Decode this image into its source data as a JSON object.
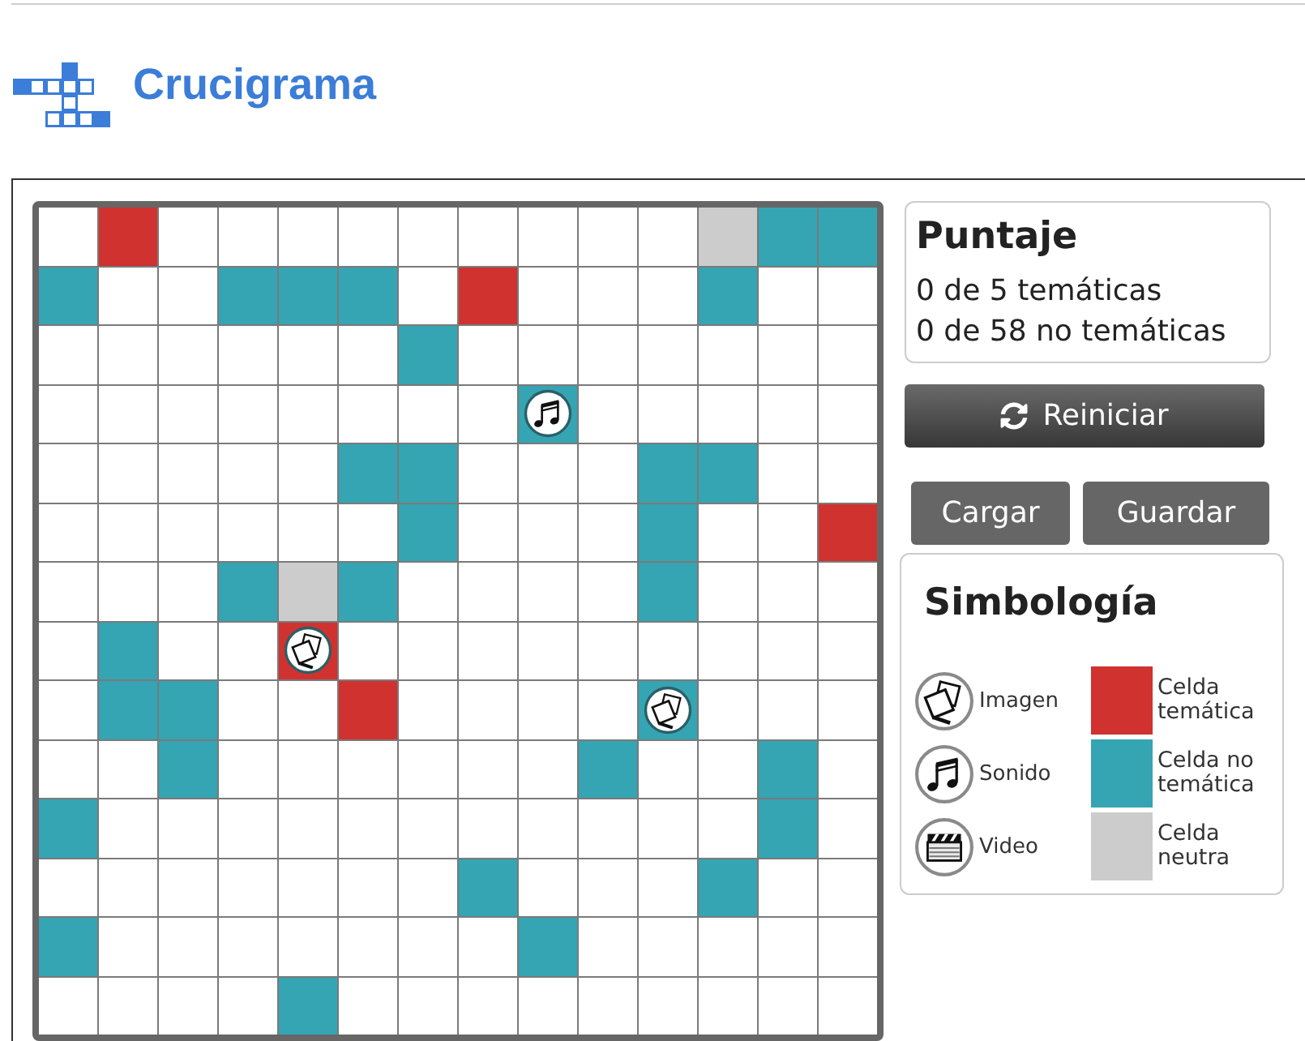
{
  "header": {
    "title": "Crucigrama"
  },
  "grid": {
    "rows": [
      [
        {
          "kind": "blank"
        },
        {
          "kind": "thematic"
        },
        {
          "kind": "blank"
        },
        {
          "kind": "blank"
        },
        {
          "kind": "blank"
        },
        {
          "kind": "blank"
        },
        {
          "kind": "blank"
        },
        {
          "kind": "blank"
        },
        {
          "kind": "blank"
        },
        {
          "kind": "blank"
        },
        {
          "kind": "blank"
        },
        {
          "kind": "neutral"
        },
        {
          "kind": "non_thematic"
        },
        {
          "kind": "non_thematic"
        }
      ],
      [
        {
          "kind": "non_thematic"
        },
        {
          "kind": "blank"
        },
        {
          "kind": "blank"
        },
        {
          "kind": "non_thematic"
        },
        {
          "kind": "non_thematic"
        },
        {
          "kind": "non_thematic"
        },
        {
          "kind": "blank"
        },
        {
          "kind": "thematic"
        },
        {
          "kind": "blank"
        },
        {
          "kind": "blank"
        },
        {
          "kind": "blank"
        },
        {
          "kind": "non_thematic"
        },
        {
          "kind": "blank"
        },
        {
          "kind": "blank"
        }
      ],
      [
        {
          "kind": "blank"
        },
        {
          "kind": "blank"
        },
        {
          "kind": "blank"
        },
        {
          "kind": "blank"
        },
        {
          "kind": "blank"
        },
        {
          "kind": "blank"
        },
        {
          "kind": "non_thematic"
        },
        {
          "kind": "blank"
        },
        {
          "kind": "blank"
        },
        {
          "kind": "blank"
        },
        {
          "kind": "blank"
        },
        {
          "kind": "blank"
        },
        {
          "kind": "blank"
        },
        {
          "kind": "blank"
        }
      ],
      [
        {
          "kind": "blank"
        },
        {
          "kind": "blank"
        },
        {
          "kind": "blank"
        },
        {
          "kind": "blank"
        },
        {
          "kind": "blank"
        },
        {
          "kind": "blank"
        },
        {
          "kind": "blank"
        },
        {
          "kind": "blank"
        },
        {
          "kind": "non_thematic",
          "media": {
            "kind": "sound"
          }
        },
        {
          "kind": "blank"
        },
        {
          "kind": "blank"
        },
        {
          "kind": "blank"
        },
        {
          "kind": "blank"
        },
        {
          "kind": "blank"
        }
      ],
      [
        {
          "kind": "blank"
        },
        {
          "kind": "blank"
        },
        {
          "kind": "blank"
        },
        {
          "kind": "blank"
        },
        {
          "kind": "blank"
        },
        {
          "kind": "non_thematic"
        },
        {
          "kind": "non_thematic"
        },
        {
          "kind": "blank"
        },
        {
          "kind": "blank"
        },
        {
          "kind": "blank"
        },
        {
          "kind": "non_thematic"
        },
        {
          "kind": "non_thematic"
        },
        {
          "kind": "blank"
        },
        {
          "kind": "blank"
        }
      ],
      [
        {
          "kind": "blank"
        },
        {
          "kind": "blank"
        },
        {
          "kind": "blank"
        },
        {
          "kind": "blank"
        },
        {
          "kind": "blank"
        },
        {
          "kind": "blank"
        },
        {
          "kind": "non_thematic"
        },
        {
          "kind": "blank"
        },
        {
          "kind": "blank"
        },
        {
          "kind": "blank"
        },
        {
          "kind": "non_thematic"
        },
        {
          "kind": "blank"
        },
        {
          "kind": "blank"
        },
        {
          "kind": "thematic"
        }
      ],
      [
        {
          "kind": "blank"
        },
        {
          "kind": "blank"
        },
        {
          "kind": "blank"
        },
        {
          "kind": "non_thematic"
        },
        {
          "kind": "neutral"
        },
        {
          "kind": "non_thematic"
        },
        {
          "kind": "blank"
        },
        {
          "kind": "blank"
        },
        {
          "kind": "blank"
        },
        {
          "kind": "blank"
        },
        {
          "kind": "non_thematic"
        },
        {
          "kind": "blank"
        },
        {
          "kind": "blank"
        },
        {
          "kind": "blank"
        }
      ],
      [
        {
          "kind": "blank"
        },
        {
          "kind": "non_thematic"
        },
        {
          "kind": "blank"
        },
        {
          "kind": "blank"
        },
        {
          "kind": "thematic",
          "media": {
            "kind": "image"
          }
        },
        {
          "kind": "blank"
        },
        {
          "kind": "blank"
        },
        {
          "kind": "blank"
        },
        {
          "kind": "blank"
        },
        {
          "kind": "blank"
        },
        {
          "kind": "blank"
        },
        {
          "kind": "blank"
        },
        {
          "kind": "blank"
        },
        {
          "kind": "blank"
        }
      ],
      [
        {
          "kind": "blank"
        },
        {
          "kind": "non_thematic"
        },
        {
          "kind": "non_thematic"
        },
        {
          "kind": "blank"
        },
        {
          "kind": "blank"
        },
        {
          "kind": "thematic"
        },
        {
          "kind": "blank"
        },
        {
          "kind": "blank"
        },
        {
          "kind": "blank"
        },
        {
          "kind": "blank"
        },
        {
          "kind": "non_thematic",
          "media": {
            "kind": "image"
          }
        },
        {
          "kind": "blank"
        },
        {
          "kind": "blank"
        },
        {
          "kind": "blank"
        }
      ],
      [
        {
          "kind": "blank"
        },
        {
          "kind": "blank"
        },
        {
          "kind": "non_thematic"
        },
        {
          "kind": "blank"
        },
        {
          "kind": "blank"
        },
        {
          "kind": "blank"
        },
        {
          "kind": "blank"
        },
        {
          "kind": "blank"
        },
        {
          "kind": "blank"
        },
        {
          "kind": "non_thematic"
        },
        {
          "kind": "blank"
        },
        {
          "kind": "blank"
        },
        {
          "kind": "non_thematic"
        },
        {
          "kind": "blank"
        }
      ],
      [
        {
          "kind": "non_thematic"
        },
        {
          "kind": "blank"
        },
        {
          "kind": "blank"
        },
        {
          "kind": "blank"
        },
        {
          "kind": "blank"
        },
        {
          "kind": "blank"
        },
        {
          "kind": "blank"
        },
        {
          "kind": "blank"
        },
        {
          "kind": "blank"
        },
        {
          "kind": "blank"
        },
        {
          "kind": "blank"
        },
        {
          "kind": "blank"
        },
        {
          "kind": "non_thematic"
        },
        {
          "kind": "blank"
        }
      ],
      [
        {
          "kind": "blank"
        },
        {
          "kind": "blank"
        },
        {
          "kind": "blank"
        },
        {
          "kind": "blank"
        },
        {
          "kind": "blank"
        },
        {
          "kind": "blank"
        },
        {
          "kind": "blank"
        },
        {
          "kind": "non_thematic"
        },
        {
          "kind": "blank"
        },
        {
          "kind": "blank"
        },
        {
          "kind": "blank"
        },
        {
          "kind": "non_thematic"
        },
        {
          "kind": "blank"
        },
        {
          "kind": "blank"
        }
      ],
      [
        {
          "kind": "non_thematic"
        },
        {
          "kind": "blank"
        },
        {
          "kind": "blank"
        },
        {
          "kind": "blank"
        },
        {
          "kind": "blank"
        },
        {
          "kind": "blank"
        },
        {
          "kind": "blank"
        },
        {
          "kind": "blank"
        },
        {
          "kind": "non_thematic"
        },
        {
          "kind": "blank"
        },
        {
          "kind": "blank"
        },
        {
          "kind": "blank"
        },
        {
          "kind": "blank"
        },
        {
          "kind": "blank"
        }
      ],
      [
        {
          "kind": "blank"
        },
        {
          "kind": "blank"
        },
        {
          "kind": "blank"
        },
        {
          "kind": "blank"
        },
        {
          "kind": "non_thematic"
        },
        {
          "kind": "blank"
        },
        {
          "kind": "blank"
        },
        {
          "kind": "blank"
        },
        {
          "kind": "blank"
        },
        {
          "kind": "blank"
        },
        {
          "kind": "blank"
        },
        {
          "kind": "blank"
        },
        {
          "kind": "blank"
        },
        {
          "kind": "blank"
        }
      ]
    ]
  },
  "score": {
    "title": "Puntaje",
    "lines": [
      "0 de 5 temáticas",
      "0 de 58 no temáticas"
    ]
  },
  "actions": {
    "reset": "Reiniciar",
    "load": "Cargar",
    "save": "Guardar"
  },
  "legend": {
    "title": "Simbología",
    "media": [
      {
        "kind": "image",
        "label": "Imagen"
      },
      {
        "kind": "sound",
        "label": "Sonido"
      },
      {
        "kind": "video",
        "label": "Video"
      }
    ],
    "cells": [
      {
        "kind": "thematic",
        "label": "Celda temática",
        "color": "#d0322f"
      },
      {
        "kind": "non_thematic",
        "label": "Celda no temática",
        "color": "#35a4b3"
      },
      {
        "kind": "neutral",
        "label": "Celda neutra",
        "color": "#cccccc"
      }
    ]
  }
}
